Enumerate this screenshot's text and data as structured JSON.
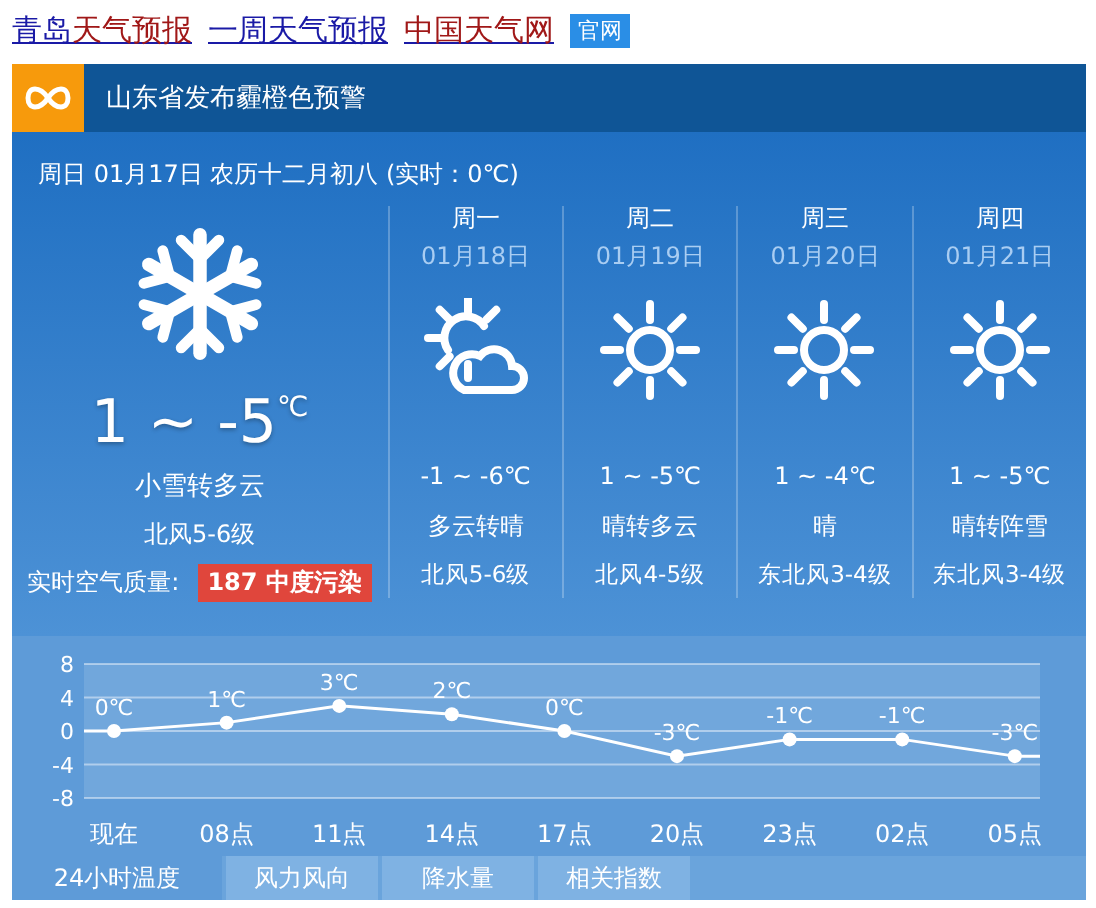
{
  "links": [
    {
      "parts": [
        {
          "text": "青岛",
          "color": "#1a1aa6"
        },
        {
          "text": "天气预报",
          "color": "#a01818"
        }
      ]
    },
    {
      "parts": [
        {
          "text": "一周天气预报",
          "color": "#1a1aa6"
        }
      ]
    },
    {
      "parts": [
        {
          "text": "中国天气网",
          "color": "#a01818"
        }
      ]
    }
  ],
  "badge": "官网",
  "alert": {
    "text": "山东省发布霾橙色预警"
  },
  "date_line": "周日 01月17日 农历十二月初八 (实时：0℃)",
  "today": {
    "temp": "1 ~ -5",
    "unit": "℃",
    "weather": "小雪转多云",
    "wind": "北风5-6级",
    "aqi_label": "实时空气质量:",
    "aqi": "187 中度污染"
  },
  "days": [
    {
      "day": "周一",
      "date": "01月18日",
      "kind": "sun-cloud",
      "temp": "-1 ~ -6℃",
      "weather": "多云转晴",
      "wind": "北风5-6级"
    },
    {
      "day": "周二",
      "date": "01月19日",
      "kind": "sun",
      "temp": "1 ~ -5℃",
      "weather": "晴转多云",
      "wind": "北风4-5级"
    },
    {
      "day": "周三",
      "date": "01月20日",
      "kind": "sun",
      "temp": "1 ~ -4℃",
      "weather": "晴",
      "wind": "东北风3-4级"
    },
    {
      "day": "周四",
      "date": "01月21日",
      "kind": "sun",
      "temp": "1 ~ -5℃",
      "weather": "晴转阵雪",
      "wind": "东北风3-4级"
    }
  ],
  "chart": {
    "chart_data": {
      "type": "line",
      "categories": [
        "现在",
        "08点",
        "11点",
        "14点",
        "17点",
        "20点",
        "23点",
        "02点",
        "05点"
      ],
      "series": [
        {
          "color": "#ffffff",
          "marker": true,
          "values": [
            0,
            1,
            3,
            2,
            0,
            -3,
            -1,
            -1,
            -3
          ]
        }
      ],
      "grid": true,
      "ylim": [
        -8,
        8
      ],
      "yticks": [
        8,
        4,
        0,
        -4,
        -8
      ],
      "value_labels": [
        "0℃",
        "1℃",
        "3℃",
        "2℃",
        "0℃",
        "-3℃",
        "-1℃",
        "-1℃",
        "-3℃"
      ]
    }
  },
  "tabs": [
    {
      "label": "24小时温度",
      "selected": true
    },
    {
      "label": "风力风向",
      "selected": false
    },
    {
      "label": "降水量",
      "selected": false
    },
    {
      "label": "相关指数",
      "selected": false
    }
  ]
}
